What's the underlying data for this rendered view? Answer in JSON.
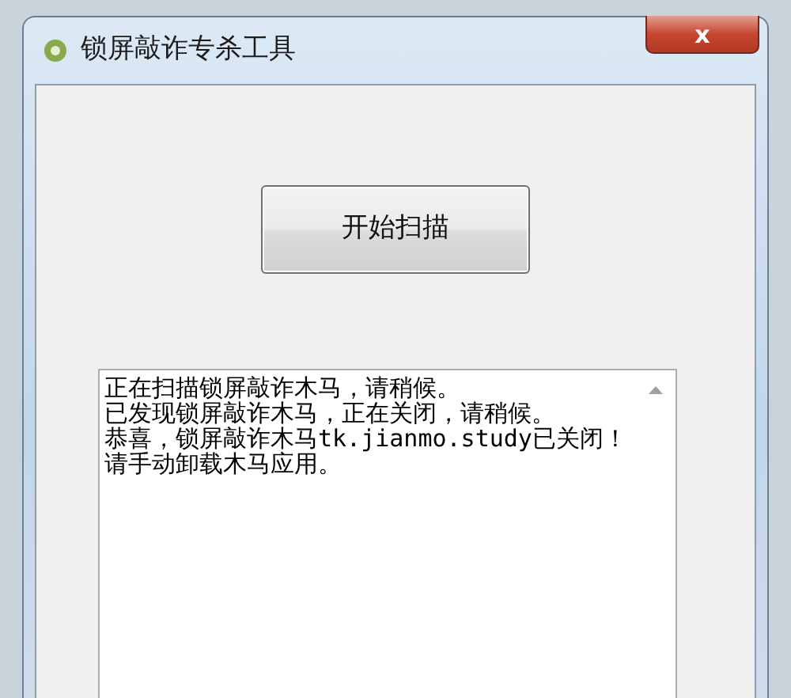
{
  "window": {
    "title": "锁屏敲诈专杀工具",
    "close": "x"
  },
  "scan_button": {
    "label": "开始扫描"
  },
  "log": {
    "lines": [
      "正在扫描锁屏敲诈木马，请稍候。",
      "已发现锁屏敲诈木马，正在关闭，请稍候。",
      "恭喜，锁屏敲诈木马tk.jianmo.study已关闭！请手动卸载木马应用。"
    ]
  }
}
